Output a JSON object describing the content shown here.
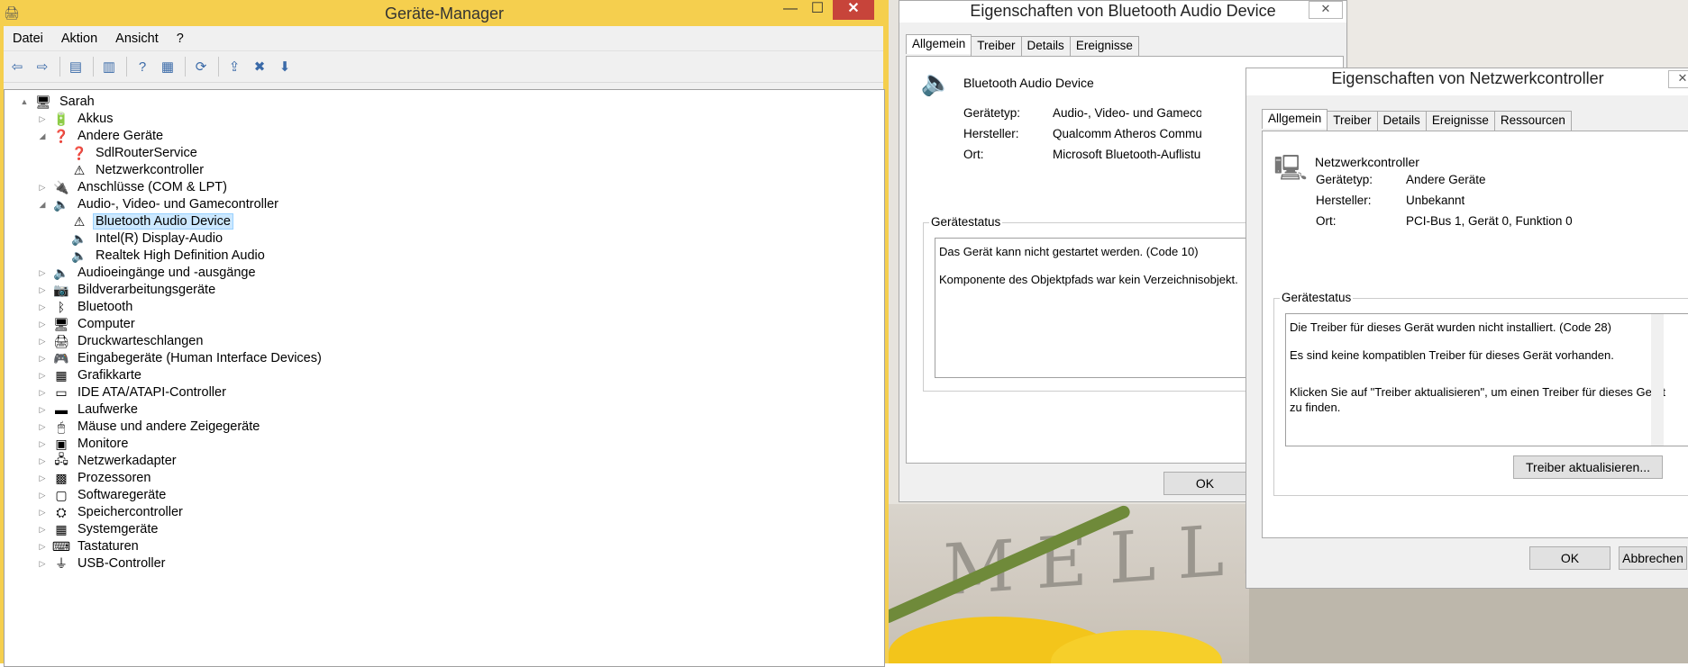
{
  "device_manager": {
    "title": "Geräte-Manager",
    "window_buttons": {
      "minimize": "—",
      "maximize": "☐",
      "close": "✕"
    },
    "menu": [
      "Datei",
      "Aktion",
      "Ansicht",
      "?"
    ],
    "toolbar_icons": [
      "back-icon",
      "forward-icon",
      "sep",
      "show-hide-icon",
      "sep",
      "properties-icon",
      "sep",
      "help-icon",
      "action-pane-icon",
      "sep",
      "scan-icon",
      "sep",
      "update-driver-icon",
      "uninstall-icon",
      "enable-icon"
    ],
    "tree": [
      {
        "label": "Sarah",
        "level": 0,
        "expand": "▲",
        "icon": "🖥"
      },
      {
        "label": "Akkus",
        "level": 1,
        "expand": "▷",
        "icon": "🔋"
      },
      {
        "label": "Andere Geräte",
        "level": 1,
        "expand": "◢",
        "icon": "❓"
      },
      {
        "label": "SdlRouterService",
        "level": 2,
        "expand": "",
        "icon": "❓"
      },
      {
        "label": "Netzwerkcontroller",
        "level": 2,
        "expand": "",
        "icon": "⚠"
      },
      {
        "label": "Anschlüsse (COM & LPT)",
        "level": 1,
        "expand": "▷",
        "icon": "🔌"
      },
      {
        "label": "Audio-, Video- und Gamecontroller",
        "level": 1,
        "expand": "◢",
        "icon": "🔈"
      },
      {
        "label": "Bluetooth Audio Device",
        "level": 2,
        "expand": "",
        "icon": "⚠",
        "selected": true
      },
      {
        "label": "Intel(R) Display-Audio",
        "level": 2,
        "expand": "",
        "icon": "🔈"
      },
      {
        "label": "Realtek High Definition Audio",
        "level": 2,
        "expand": "",
        "icon": "🔈"
      },
      {
        "label": "Audioeingänge und -ausgänge",
        "level": 1,
        "expand": "▷",
        "icon": "🔈"
      },
      {
        "label": "Bildverarbeitungsgeräte",
        "level": 1,
        "expand": "▷",
        "icon": "📷"
      },
      {
        "label": "Bluetooth",
        "level": 1,
        "expand": "▷",
        "icon": "ᛒ"
      },
      {
        "label": "Computer",
        "level": 1,
        "expand": "▷",
        "icon": "🖥"
      },
      {
        "label": "Druckwarteschlangen",
        "level": 1,
        "expand": "▷",
        "icon": "🖨"
      },
      {
        "label": "Eingabegeräte (Human Interface Devices)",
        "level": 1,
        "expand": "▷",
        "icon": "🎮"
      },
      {
        "label": "Grafikkarte",
        "level": 1,
        "expand": "▷",
        "icon": "▦"
      },
      {
        "label": "IDE ATA/ATAPI-Controller",
        "level": 1,
        "expand": "▷",
        "icon": "▭"
      },
      {
        "label": "Laufwerke",
        "level": 1,
        "expand": "▷",
        "icon": "▬"
      },
      {
        "label": "Mäuse und andere Zeigegeräte",
        "level": 1,
        "expand": "▷",
        "icon": "🖱"
      },
      {
        "label": "Monitore",
        "level": 1,
        "expand": "▷",
        "icon": "▣"
      },
      {
        "label": "Netzwerkadapter",
        "level": 1,
        "expand": "▷",
        "icon": "🖧"
      },
      {
        "label": "Prozessoren",
        "level": 1,
        "expand": "▷",
        "icon": "▩"
      },
      {
        "label": "Softwaregeräte",
        "level": 1,
        "expand": "▷",
        "icon": "▢"
      },
      {
        "label": "Speichercontroller",
        "level": 1,
        "expand": "▷",
        "icon": "⛭"
      },
      {
        "label": "Systemgeräte",
        "level": 1,
        "expand": "▷",
        "icon": "▦"
      },
      {
        "label": "Tastaturen",
        "level": 1,
        "expand": "▷",
        "icon": "⌨"
      },
      {
        "label": "USB-Controller",
        "level": 1,
        "expand": "▷",
        "icon": "⏚"
      }
    ]
  },
  "dialog_bt": {
    "title": "Eigenschaften von Bluetooth Audio Device",
    "close": "✕",
    "tabs": [
      "Allgemein",
      "Treiber",
      "Details",
      "Ereignisse"
    ],
    "device_name": "Bluetooth Audio Device",
    "props": [
      {
        "label": "Gerätetyp:",
        "value": "Audio-, Video- und Gamecontroller"
      },
      {
        "label": "Hersteller:",
        "value": "Qualcomm Atheros Communications"
      },
      {
        "label": "Ort:",
        "value": "Microsoft Bluetooth-Auflistung"
      }
    ],
    "status_title": "Gerätestatus",
    "status_lines": [
      "Das Gerät kann nicht gestartet werden. (Code 10)",
      "Komponente des Objektpfads war kein Verzeichnisobjekt."
    ],
    "ok": "OK"
  },
  "dialog_net": {
    "title": "Eigenschaften von Netzwerkcontroller",
    "close": "✕",
    "tabs": [
      "Allgemein",
      "Treiber",
      "Details",
      "Ereignisse",
      "Ressourcen"
    ],
    "device_name": "Netzwerkcontroller",
    "props": [
      {
        "label": "Gerätetyp:",
        "value": "Andere Geräte"
      },
      {
        "label": "Hersteller:",
        "value": "Unbekannt"
      },
      {
        "label": "Ort:",
        "value": "PCI-Bus 1, Gerät 0, Funktion 0"
      }
    ],
    "status_title": "Gerätestatus",
    "status_lines": [
      "Die Treiber für dieses Gerät wurden nicht installiert. (Code 28)",
      "Es sind keine kompatiblen Treiber für dieses Gerät vorhanden.",
      "Klicken Sie auf \"Treiber aktualisieren\", um einen Treiber für dieses Gerät zu finden."
    ],
    "update_button": "Treiber aktualisieren...",
    "ok": "OK",
    "cancel": "Abbrechen"
  },
  "desktop": {
    "wall_letters": "MELLA"
  }
}
